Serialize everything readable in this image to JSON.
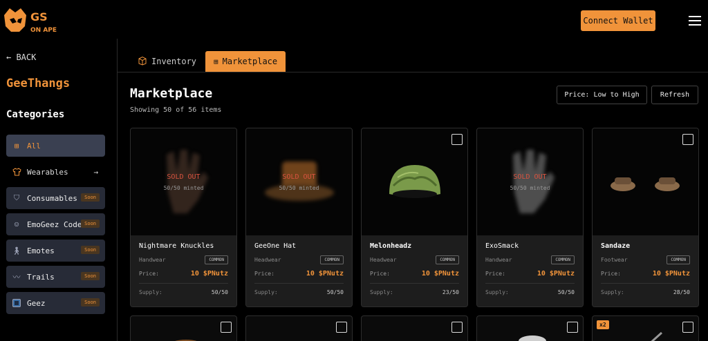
{
  "header": {
    "logo_text": "GS ON APE",
    "connect_label": "Connect Wallet"
  },
  "sidebar": {
    "back_label": "← BACK",
    "brand": "GeeThangs",
    "categories_title": "Categories",
    "items": [
      {
        "label": "All",
        "icon": "grid-icon",
        "soon": ""
      },
      {
        "label": "Wearables",
        "icon": "shirt-icon",
        "soon": "",
        "arrow": "→"
      },
      {
        "label": "Consumables",
        "icon": "shield-icon",
        "soon": "Soon"
      },
      {
        "label": "EmoGeez Code",
        "icon": "smile-icon",
        "soon": "Soon"
      },
      {
        "label": "Emotes",
        "icon": "walk-icon",
        "soon": "Soon"
      },
      {
        "label": "Trails",
        "icon": "trail-icon",
        "soon": "Soon"
      },
      {
        "label": "Geez",
        "icon": "geez-icon",
        "soon": "Soon"
      }
    ]
  },
  "tabs": {
    "inventory": "Inventory",
    "marketplace": "Marketplace"
  },
  "main": {
    "title": "Marketplace",
    "showing": "Showing 50 of 56 items",
    "sort_label": "Price: Low to High",
    "refresh_label": "Refresh"
  },
  "cards": [
    {
      "name": "Nightmare Knuckles",
      "category": "Handwear",
      "rarity": "COMMON",
      "price_label": "Price:",
      "price": "10 $PNutz",
      "supply_label": "Supply:",
      "supply": "50/50",
      "sold_out": "SOLD OUT",
      "minted": "50/50 minted"
    },
    {
      "name": "GeeOne Hat",
      "category": "Headwear",
      "rarity": "COMMON",
      "price_label": "Price:",
      "price": "10 $PNutz",
      "supply_label": "Supply:",
      "supply": "50/50",
      "sold_out": "SOLD OUT",
      "minted": "50/50 minted"
    },
    {
      "name": "Melonheadz",
      "category": "Headwear",
      "rarity": "COMMON",
      "price_label": "Price:",
      "price": "10 $PNutz",
      "supply_label": "Supply:",
      "supply": "23/50"
    },
    {
      "name": "ExoSmack",
      "category": "Handwear",
      "rarity": "COMMON",
      "price_label": "Price:",
      "price": "10 $PNutz",
      "supply_label": "Supply:",
      "supply": "50/50",
      "sold_out": "SOLD OUT",
      "minted": "50/50 minted"
    },
    {
      "name": "Sandaze",
      "category": "Footwear",
      "rarity": "COMMON",
      "price_label": "Price:",
      "price": "10 $PNutz",
      "supply_label": "Supply:",
      "supply": "28/50"
    }
  ],
  "second_row": {
    "badge": "x2"
  },
  "colors": {
    "accent": "#f0933a",
    "sold": "#d9533f",
    "sidebar_active": "#3a4051"
  }
}
